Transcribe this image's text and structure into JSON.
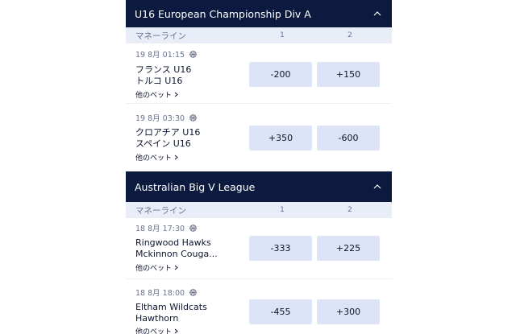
{
  "leagues": [
    {
      "title": "U16 European Championship Div A",
      "market_label": "マネーライン",
      "col1": "1",
      "col2": "2",
      "events": [
        {
          "time": "19 8月 01:15",
          "home": "フランス U16",
          "away": "トルコ U16",
          "more": "他のベット",
          "odd1": "-200",
          "odd2": "+150"
        },
        {
          "time": "19 8月 03:30",
          "home": "クロアチア U16",
          "away": "スペイン U16",
          "more": "他のベット",
          "odd1": "+350",
          "odd2": "-600"
        }
      ]
    },
    {
      "title": "Australian Big V League",
      "market_label": "マネーライン",
      "col1": "1",
      "col2": "2",
      "events": [
        {
          "time": "18 8月 17:30",
          "home": "Ringwood Hawks",
          "away": "Mckinnon Couga...",
          "more": "他のベット",
          "odd1": "-333",
          "odd2": "+225"
        },
        {
          "time": "18 8月 18:00",
          "home": "Eltham Wildcats",
          "away": "Hawthorn",
          "more": "他のベット",
          "odd1": "-455",
          "odd2": "+300"
        }
      ]
    }
  ]
}
